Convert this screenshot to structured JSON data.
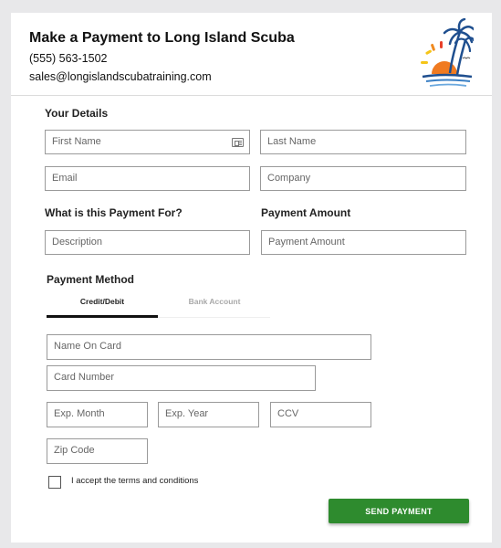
{
  "header": {
    "title": "Make a Payment to Long Island Scuba",
    "phone": "(555) 563-1502",
    "email": "sales@longislandscubatraining.com",
    "logo_icon": "beach-sun-palm-logo"
  },
  "details": {
    "heading": "Your Details",
    "first_name_placeholder": "First Name",
    "last_name_placeholder": "Last Name",
    "email_placeholder": "Email",
    "company_placeholder": "Company"
  },
  "payment_for": {
    "heading": "What is this Payment For?",
    "description_placeholder": "Description"
  },
  "amount": {
    "heading": "Payment Amount",
    "amount_placeholder": "Payment Amount"
  },
  "method": {
    "heading": "Payment Method",
    "tabs": [
      {
        "label": "Credit/Debit",
        "active": true
      },
      {
        "label": "Bank Account",
        "active": false
      }
    ],
    "name_on_card_placeholder": "Name On Card",
    "card_number_placeholder": "Card Number",
    "exp_month_placeholder": "Exp. Month",
    "exp_year_placeholder": "Exp. Year",
    "ccv_placeholder": "CCV",
    "zip_placeholder": "Zip Code"
  },
  "terms": {
    "label": "I accept the terms and conditions",
    "checked": false
  },
  "submit": {
    "label": "SEND PAYMENT"
  },
  "colors": {
    "submit_bg": "#2e8b2e",
    "sun": "#f0a030",
    "palm": "#1f4f8f",
    "water": "#3a7fc4"
  }
}
